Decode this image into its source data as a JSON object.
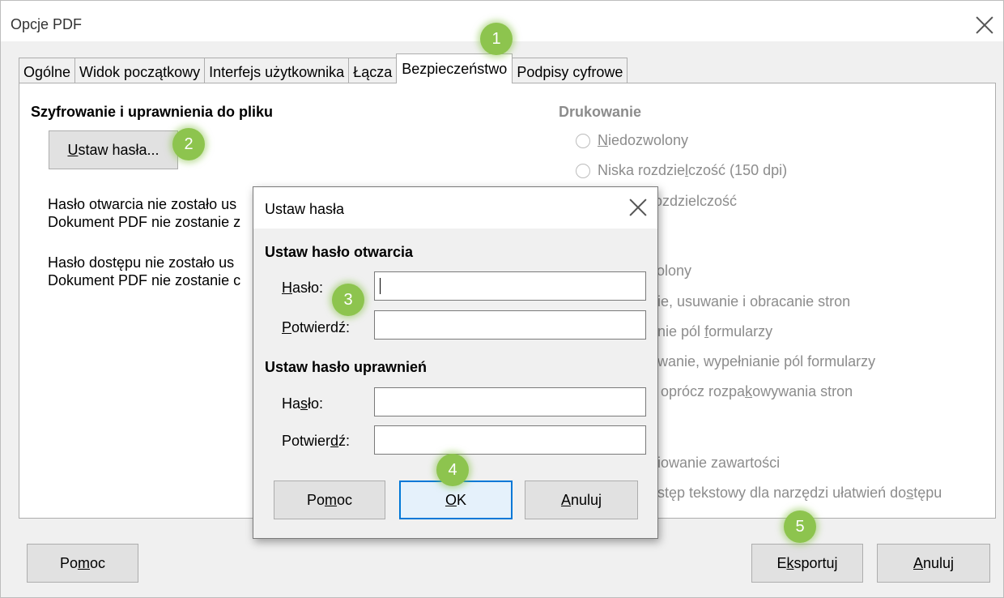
{
  "window": {
    "title": "Opcje PDF"
  },
  "tabs": [
    "Ogólne",
    "Widok początkowy",
    "Interfejs użytkownika",
    "Łącza",
    "Bezpieczeństwo",
    "Podpisy cyfrowe"
  ],
  "security": {
    "heading": "Szyfrowanie i uprawnienia do pliku",
    "set_passwords_button": {
      "first": "U",
      "rest": "staw hasła..."
    },
    "open_pw_line1": "Hasło otwarcia nie zostało us",
    "open_pw_line2": "Dokument PDF nie zostanie z",
    "access_pw_line1": "Hasło dostępu nie zostało us",
    "access_pw_line2": "Dokument PDF nie zostanie c"
  },
  "printing": {
    "heading": "Drukowanie",
    "not_permitted": {
      "first": "N",
      "rest": "iedozwolony"
    },
    "low_res": {
      "pre": "Niska rozdzie",
      "u": "l",
      "post": "czość (150 dpi)"
    },
    "high_res_partial": "rozdzielczość"
  },
  "changes_partial": {
    "not_permitted": "zolony",
    "insert_delete_rotate": "nie, usuwanie i obracanie stron",
    "fill_forms": {
      "pre": "anie pól ",
      "u": "f",
      "post": "ormularzy"
    },
    "comment_fill": "owanie, wypełnianie pól formularzy",
    "any_except": {
      "pre": "y oprócz rozpa",
      "u": "k",
      "post": "owywania stron"
    }
  },
  "content_partial": {
    "copy": "piowanie zawartości",
    "accessibility": {
      "pre": "ostęp tekstowy dla narzędzi ułatwień do",
      "u": "s",
      "post": "tępu"
    }
  },
  "footer": {
    "help": {
      "pre": "Po",
      "u": "m",
      "post": "oc"
    },
    "export": {
      "pre": "E",
      "u": "k",
      "post": "sportuj"
    },
    "cancel": {
      "u": "A",
      "post": "nuluj"
    }
  },
  "dialog": {
    "title": "Ustaw hasła",
    "open_section": "Ustaw hasło otwarcia",
    "open_password_label": {
      "u": "H",
      "post": "asło:"
    },
    "open_confirm_label": {
      "u": "P",
      "post": "otwierdź:"
    },
    "open_password_value": "",
    "open_confirm_value": "",
    "perm_section": "Ustaw hasło uprawnień",
    "perm_password_label": {
      "pre": "Ha",
      "u": "s",
      "post": "ło:"
    },
    "perm_confirm_label": {
      "pre": "Potwier",
      "u": "d",
      "post": "ź:"
    },
    "perm_password_value": "",
    "perm_confirm_value": "",
    "help": {
      "pre": "Po",
      "u": "m",
      "post": "oc"
    },
    "ok": {
      "u": "O",
      "post": "K"
    },
    "cancel": {
      "u": "A",
      "post": "nuluj"
    }
  },
  "badges": [
    "1",
    "2",
    "3",
    "4",
    "5"
  ],
  "colors": {
    "badge": "#8dc44e",
    "focus_border": "#0078d7",
    "disabled_text": "#8c8c8c"
  }
}
